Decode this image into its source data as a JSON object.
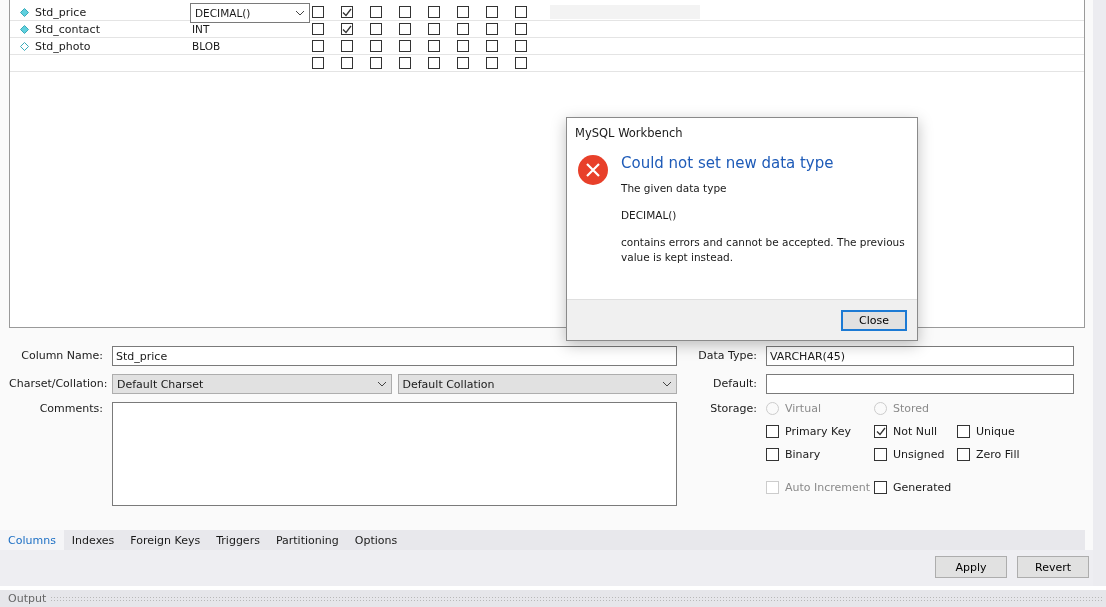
{
  "columns_grid": {
    "rows": [
      {
        "name": "Std_price",
        "not_null": true,
        "type": "DECIMAL()",
        "editing": true,
        "selected": true,
        "flags": [
          false,
          true,
          false,
          false,
          false,
          false,
          false,
          false
        ]
      },
      {
        "name": "Std_contact",
        "not_null": true,
        "type": "INT",
        "editing": false,
        "selected": false,
        "flags": [
          false,
          true,
          false,
          false,
          false,
          false,
          false,
          false
        ]
      },
      {
        "name": "Std_photo",
        "not_null": false,
        "type": "BLOB",
        "editing": false,
        "selected": false,
        "flags": [
          false,
          false,
          false,
          false,
          false,
          false,
          false,
          false
        ]
      },
      {
        "flags": [
          false,
          false,
          false,
          false,
          false,
          false,
          false,
          false
        ]
      }
    ]
  },
  "dialog": {
    "title": "MySQL Workbench",
    "heading": "Could not set new data type",
    "lines": [
      "The given data type",
      "DECIMAL()",
      "contains errors and cannot be accepted. The previous value is kept instead."
    ],
    "button": "Close"
  },
  "form": {
    "column_name_label": "Column Name:",
    "column_name": "Std_price",
    "charset_label": "Charset/Collation:",
    "charset": "Default Charset",
    "collation": "Default Collation",
    "comments_label": "Comments:",
    "data_type_label": "Data Type:",
    "data_type": "VARCHAR(45)",
    "default_label": "Default:",
    "storage_label": "Storage:",
    "storage": [
      {
        "label": "Virtual",
        "selected": false,
        "disabled": true
      },
      {
        "label": "Stored",
        "selected": false,
        "disabled": true
      }
    ],
    "options": [
      {
        "label": "Primary Key",
        "checked": false,
        "disabled": false
      },
      {
        "label": "Not Null",
        "checked": true,
        "disabled": false
      },
      {
        "label": "Unique",
        "checked": false,
        "disabled": false
      },
      {
        "label": "Binary",
        "checked": false,
        "disabled": false
      },
      {
        "label": "Unsigned",
        "checked": false,
        "disabled": false
      },
      {
        "label": "Zero Fill",
        "checked": false,
        "disabled": false
      },
      {
        "label": "Auto Increment",
        "checked": false,
        "disabled": true
      },
      {
        "label": "Generated",
        "checked": false,
        "disabled": false
      }
    ]
  },
  "tabs": [
    {
      "label": "Columns",
      "selected": true
    },
    {
      "label": "Indexes",
      "selected": false
    },
    {
      "label": "Foreign Keys",
      "selected": false
    },
    {
      "label": "Triggers",
      "selected": false
    },
    {
      "label": "Partitioning",
      "selected": false
    },
    {
      "label": "Options",
      "selected": false
    }
  ],
  "buttons": [
    "Apply",
    "Revert"
  ],
  "output_label": "Output"
}
